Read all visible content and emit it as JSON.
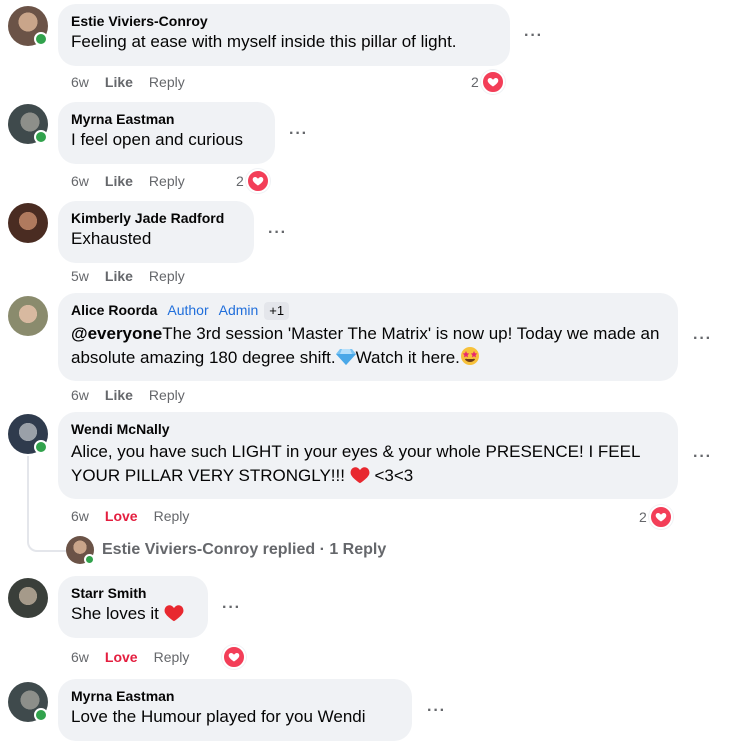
{
  "comments": [
    {
      "author": "Estie Viviers-Conroy",
      "text": "Feeling at ease with myself inside this pillar of light.",
      "time": "6w",
      "like": "Like",
      "reply": "Reply",
      "reactions": "2"
    },
    {
      "author": "Myrna Eastman",
      "text": "I feel open and curious",
      "time": "6w",
      "like": "Like",
      "reply": "Reply",
      "reactions": "2"
    },
    {
      "author": "Kimberly Jade Radford",
      "text": "Exhausted",
      "time": "5w",
      "like": "Like",
      "reply": "Reply"
    },
    {
      "author": "Alice Roorda",
      "badge_author": "Author",
      "badge_admin": "Admin",
      "badge_more": "+1",
      "mention": "@everyone",
      "text_part1": "The 3rd session 'Master The Matrix' is now up! Today we made an absolute amazing 180 degree shift.",
      "text_part2": "Watch it here.",
      "time": "6w",
      "like": "Like",
      "reply": "Reply"
    },
    {
      "author": "Wendi McNally",
      "text": "Alice, you have such LIGHT in your eyes & your whole PRESENCE! I FEEL YOUR PILLAR VERY STRONGLY!!!",
      "text_tail": " <3<3",
      "time": "6w",
      "like": "Love",
      "reply": "Reply",
      "reactions": "2"
    },
    {
      "author": "Starr Smith",
      "text": "She loves it",
      "time": "6w",
      "like": "Love",
      "reply": "Reply"
    },
    {
      "author": "Myrna Eastman",
      "text": "Love the Humour played for you Wendi"
    }
  ],
  "reply_summary": {
    "text": "Estie Viviers-Conroy replied · 1 Reply"
  },
  "more_icon": "more-options-icon",
  "colors": {
    "bubble": "#f0f2f5",
    "secondary_text": "#65676b",
    "love_red": "#e41e3f",
    "heart_badge": "#f33e58",
    "badge_blue": "#216fdb",
    "online_green": "#31a24c"
  }
}
